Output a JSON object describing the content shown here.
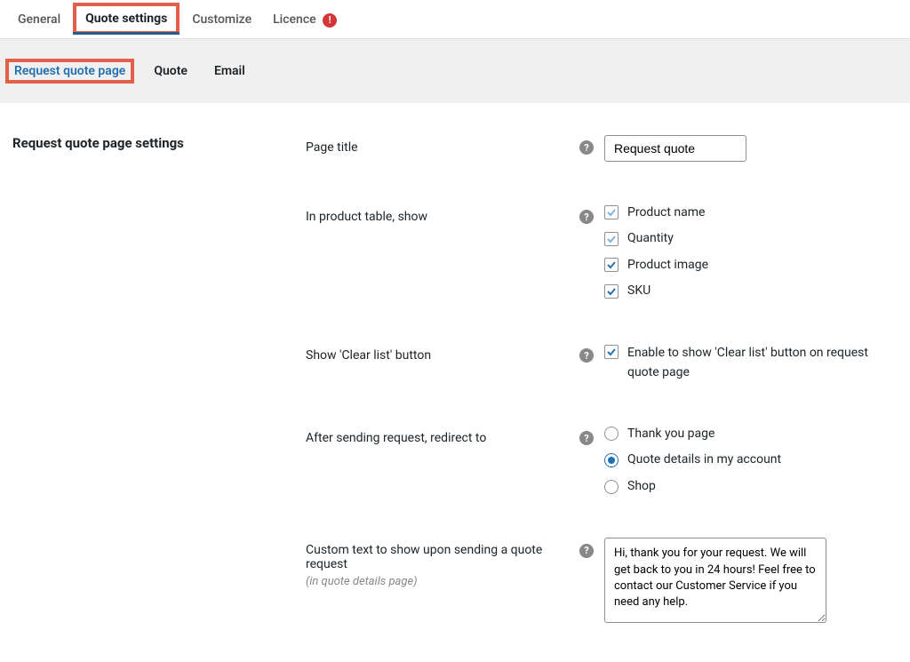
{
  "topnav": {
    "tabs": [
      {
        "label": "General"
      },
      {
        "label": "Quote settings",
        "active": true,
        "highlighted": true
      },
      {
        "label": "Customize"
      },
      {
        "label": "Licence",
        "alert": "!"
      }
    ]
  },
  "subnav": {
    "tabs": [
      {
        "label": "Request quote page",
        "active": true,
        "highlighted": true
      },
      {
        "label": "Quote"
      },
      {
        "label": "Email"
      }
    ]
  },
  "section": {
    "heading": "Request quote page settings"
  },
  "fields": {
    "page_title": {
      "label": "Page title",
      "value": "Request quote"
    },
    "product_table": {
      "label": "In product table, show",
      "options": [
        {
          "label": "Product name",
          "checked": true,
          "style": "light"
        },
        {
          "label": "Quantity",
          "checked": true,
          "style": "light"
        },
        {
          "label": "Product image",
          "checked": true,
          "style": "solid"
        },
        {
          "label": "SKU",
          "checked": true,
          "style": "solid"
        }
      ]
    },
    "clear_list": {
      "label": "Show 'Clear list' button",
      "checkbox_label": "Enable to show 'Clear list' button on request quote page",
      "checked": true
    },
    "redirect": {
      "label": "After sending request, redirect to",
      "options": [
        {
          "label": "Thank you page",
          "selected": false
        },
        {
          "label": "Quote details in my account",
          "selected": true
        },
        {
          "label": "Shop",
          "selected": false
        }
      ]
    },
    "custom_text": {
      "label": "Custom text to show upon sending a quote request",
      "sublabel": "(in quote details page)",
      "value": "Hi, thank you for your request. We will get back to you in 24 hours! Feel free to contact our Customer Service if you need any help."
    }
  }
}
